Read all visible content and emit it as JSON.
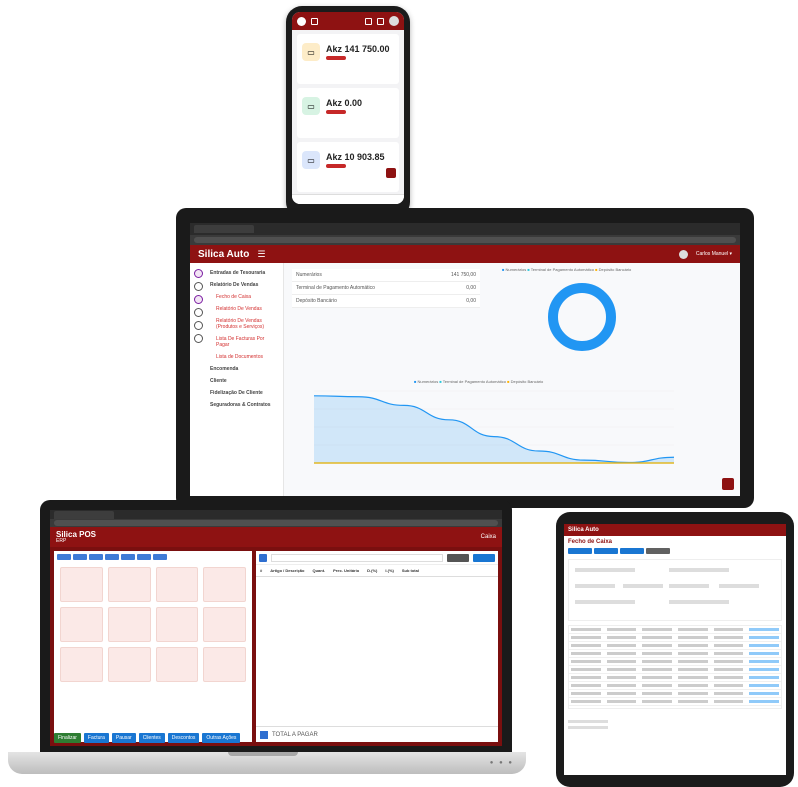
{
  "phone": {
    "cards": [
      {
        "title": "",
        "amount": "Akz 141 750.00",
        "icon_color": "#fdecc8",
        "icon": "wallet-icon"
      },
      {
        "title": "",
        "amount": "Akz 0.00",
        "icon_color": "#d7f3e3",
        "icon": "money-icon"
      },
      {
        "title": "",
        "amount": "Akz 10 903.85",
        "icon_color": "#dbe6fb",
        "icon": "card-icon"
      }
    ]
  },
  "monitor": {
    "brand": "Silica Auto",
    "menu_icon": "☰",
    "user": "Carlos Manuel ▾",
    "nav": [
      {
        "label": "Entradas de Tesouraria",
        "kind": "grp"
      },
      {
        "label": "Relatório De Vendas",
        "kind": "grp"
      },
      {
        "label": "Fecho de Caixa",
        "kind": "sub"
      },
      {
        "label": "Relatório De Vendas",
        "kind": "sub"
      },
      {
        "label": "Relatório De Vendas (Produtos e Serviços)",
        "kind": "sub"
      },
      {
        "label": "Lista De Facturas Por Pagar",
        "kind": "sub"
      },
      {
        "label": "Lista de Documentos",
        "kind": "sub"
      },
      {
        "label": "Encomenda",
        "kind": "grp"
      },
      {
        "label": "Cliente",
        "kind": "grp"
      },
      {
        "label": "Fidelização De Cliente",
        "kind": "grp"
      },
      {
        "label": "Seguradoras & Contratos",
        "kind": "grp"
      }
    ],
    "stats": [
      {
        "label": "Numerários",
        "value": "141 750,00"
      },
      {
        "label": "Terminal de Pagamento Automático",
        "value": "0,00"
      },
      {
        "label": "Depósito Bancário",
        "value": "0,00"
      }
    ]
  },
  "laptop": {
    "brand": "Silica POS",
    "brand_sub": "ERP",
    "caixa": "Caixa",
    "table_headers": [
      "#",
      "Artigo / Descrição",
      "Quant.",
      "Prec. Unitário",
      "D.(%)",
      "I.(%)",
      "Sub total"
    ],
    "total_label": "TOTAL A PAGAR",
    "actions": [
      "Finalizar",
      "Factura",
      "Pausar",
      "Clientes",
      "Descontos",
      "Outras Ações"
    ]
  },
  "tablet": {
    "brand": "Silica Auto",
    "title": "Fecho de Caixa"
  },
  "chart_data": [
    {
      "type": "pie",
      "title": "",
      "categories": [
        "Numerários",
        "Terminal de Pagamento Automático",
        "Depósito Bancário"
      ],
      "values": [
        141750,
        0,
        0
      ],
      "colors": [
        "#2196f3",
        "#26c6da",
        "#ffb300"
      ],
      "legend": "top",
      "donut": true
    },
    {
      "type": "area",
      "title": "",
      "x": [
        0,
        1,
        2,
        3,
        4,
        5,
        6,
        7,
        8
      ],
      "series": [
        {
          "name": "Numerários",
          "values": [
            140000,
            138000,
            120000,
            90000,
            55000,
            25000,
            6000,
            1000,
            12000
          ]
        },
        {
          "name": "Terminal de Pagamento Automático",
          "values": [
            0,
            0,
            0,
            0,
            0,
            0,
            0,
            0,
            0
          ]
        },
        {
          "name": "Depósito Bancário",
          "values": [
            0,
            0,
            0,
            0,
            0,
            0,
            0,
            0,
            0
          ]
        }
      ],
      "ylim": [
        0,
        150000
      ],
      "legend": "top",
      "colors": [
        "#2196f3",
        "#26c6da",
        "#ffb300"
      ]
    }
  ]
}
